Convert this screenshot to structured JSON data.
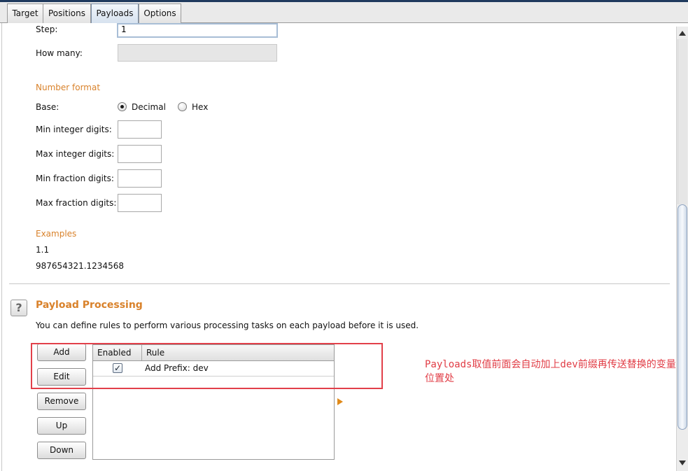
{
  "tabs": [
    {
      "label": "Target",
      "active": false
    },
    {
      "label": "Positions",
      "active": false
    },
    {
      "label": "Payloads",
      "active": true
    },
    {
      "label": "Options",
      "active": false
    }
  ],
  "fields": {
    "step_label": "Step:",
    "step_value": "1",
    "how_many_label": "How many:",
    "how_many_value": ""
  },
  "number_format": {
    "heading": "Number format",
    "base_label": "Base:",
    "base_options": [
      "Decimal",
      "Hex"
    ],
    "base_selected": "Decimal",
    "min_integer_label": "Min integer digits:",
    "max_integer_label": "Max integer digits:",
    "min_fraction_label": "Min fraction digits:",
    "max_fraction_label": "Max fraction digits:",
    "min_integer_value": "",
    "max_integer_value": "",
    "min_fraction_value": "",
    "max_fraction_value": ""
  },
  "examples": {
    "heading": "Examples",
    "items": [
      "1.1",
      "987654321.1234568"
    ]
  },
  "processing": {
    "help_icon": "?",
    "heading": "Payload Processing",
    "description": "You can define rules to perform various processing tasks on each payload before it is used.",
    "buttons": {
      "add": "Add",
      "edit": "Edit",
      "remove": "Remove",
      "up": "Up",
      "down": "Down"
    },
    "table": {
      "columns": [
        "Enabled",
        "Rule"
      ],
      "rows": [
        {
          "enabled_mark": "✓",
          "rule": "Add Prefix: dev"
        }
      ]
    }
  },
  "annotation": {
    "text": "Payloads取值前面会自动加上dev前缀再传送替换的变量位置处"
  },
  "colors": {
    "accent_orange": "#d9822b",
    "annotation_red": "#e13c45"
  },
  "icons": {
    "help": "question-icon",
    "expand": "triangle-right-icon",
    "check": "checkmark-icon"
  }
}
